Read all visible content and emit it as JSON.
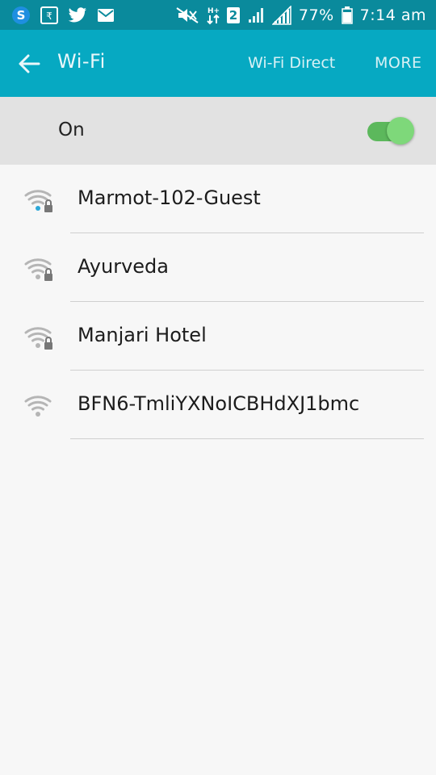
{
  "status_bar": {
    "icons": [
      "skype-icon",
      "rupee-app-icon",
      "twitter-icon",
      "email-icon",
      "mute-icon",
      "data-transfer-icon",
      "sim2-icon",
      "signal-icon",
      "signal-icon",
      "battery-icon"
    ],
    "sim_label": "2",
    "battery": "77%",
    "time": "7:14 am",
    "color": "#0a8a9c"
  },
  "app_bar": {
    "title": "Wi-Fi",
    "wifi_direct": "Wi-Fi Direct",
    "more": "MORE",
    "color": "#06a9c2"
  },
  "wifi_toggle": {
    "label": "On",
    "state": "on",
    "color": "#5cb85c"
  },
  "networks": [
    {
      "name": "Marmot-102-Guest",
      "secured": true,
      "signal_icon": "wifi-lock-icon"
    },
    {
      "name": "Ayurveda",
      "secured": true,
      "signal_icon": "wifi-lock-icon"
    },
    {
      "name": "Manjari Hotel",
      "secured": true,
      "signal_icon": "wifi-lock-icon"
    },
    {
      "name": "BFN6-TmliYXNoICBHdXJ1bmc",
      "secured": false,
      "signal_icon": "wifi-icon"
    }
  ]
}
